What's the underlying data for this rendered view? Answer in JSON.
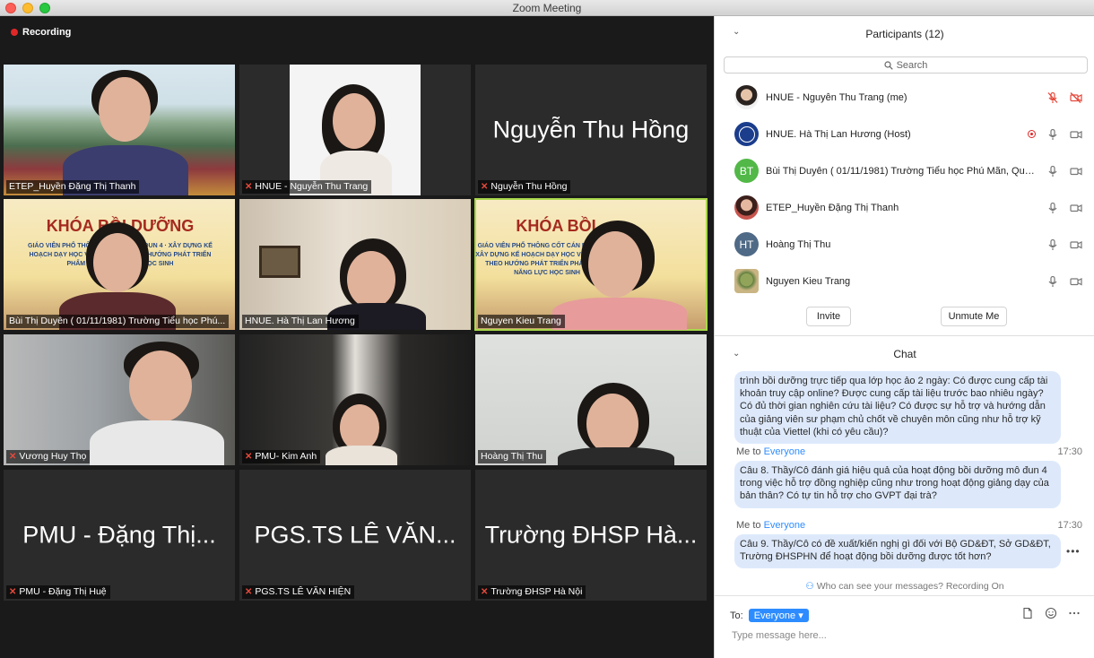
{
  "window": {
    "title": "Zoom Meeting"
  },
  "recording": {
    "label": "Recording"
  },
  "gallery": [
    {
      "name": "ETEP_Huyền Đặng Thị Thanh",
      "muted": false,
      "video": true
    },
    {
      "name": "HNUE - Nguyễn Thu Trang",
      "muted": true,
      "video": true
    },
    {
      "name": "Nguyễn Thu Hồng",
      "muted": true,
      "video": false,
      "big_name": "Nguyễn Thu Hồng"
    },
    {
      "name": "Bùi Thị Duyên ( 01/11/1981) Trường Tiểu học Phú...",
      "muted": false,
      "video": true
    },
    {
      "name": "HNUE. Hà Thị Lan Hương",
      "muted": false,
      "video": true
    },
    {
      "name": "Nguyen Kieu Trang",
      "muted": false,
      "video": true,
      "active": true
    },
    {
      "name": "Vương Huy Thọ",
      "muted": true,
      "video": true
    },
    {
      "name": "PMU- Kim Anh",
      "muted": true,
      "video": true
    },
    {
      "name": "Hoàng Thị Thu",
      "muted": false,
      "video": true
    },
    {
      "name": "PMU - Đặng Thị Huệ",
      "muted": true,
      "video": false,
      "big_name": "PMU - Đặng Thị..."
    },
    {
      "name": "PGS.TS LÊ VĂN HIỆN",
      "muted": true,
      "video": false,
      "big_name": "PGS.TS LÊ VĂN..."
    },
    {
      "name": "Trường ĐHSP Hà Nội",
      "muted": true,
      "video": false,
      "big_name": "Trường ĐHSP Hà..."
    }
  ],
  "banner": {
    "title_left": "KHÓA BỒI DƯỠNG",
    "title_right": "KHÓA BỒI",
    "sub": "GIÁO VIÊN PHỔ THÔNG CỐT CÁN MÔ ĐUN 4 · XÂY DỰNG KẾ HOẠCH DẠY HỌC VÀ GIÁO DỤC THEO HƯỚNG PHÁT TRIỂN PHẨM CHẤT, NĂNG LỰC HỌC SINH"
  },
  "participants_panel": {
    "title": "Participants (12)",
    "search_placeholder": "Search",
    "items": [
      {
        "name": "HNUE - Nguyễn Thu Trang (me)",
        "avatar": "photo",
        "mic": "muted",
        "cam": "off"
      },
      {
        "name": "HNUE. Hà Thị Lan Hương (Host)",
        "avatar": "logo",
        "mic": "on",
        "cam": "on",
        "recording": true
      },
      {
        "name": "Bùi Thị Duyên ( 01/11/1981) Trường Tiểu học Phú Mãn, Quố...",
        "avatar": "initials",
        "initials": "BT",
        "mic": "on",
        "cam": "on"
      },
      {
        "name": "ETEP_Huyền Đặng Thị Thanh",
        "avatar": "photo",
        "mic": "on",
        "cam": "on"
      },
      {
        "name": "Hoàng Thị Thu",
        "avatar": "initials",
        "initials": "HT",
        "mic": "on",
        "cam": "on"
      },
      {
        "name": "Nguyen Kieu Trang",
        "avatar": "photo",
        "mic": "on",
        "cam": "on"
      }
    ],
    "invite_label": "Invite",
    "unmute_label": "Unmute Me"
  },
  "chat": {
    "title": "Chat",
    "messages": [
      {
        "text": "trình bồi dưỡng trực tiếp qua lớp học ảo 2 ngày: Có được cung cấp tài khoản truy cập online? Được cung cấp tài liệu trước bao nhiêu ngày? Có đủ thời gian nghiên cứu tài liệu? Có được sự hỗ trợ và hướng dẫn của giảng viên sư phạm chủ chốt về chuyên môn cũng như hỗ trợ kỹ thuật của Viettel (khi có yêu cầu)?"
      },
      {
        "from": "Me",
        "to_word": "to",
        "to": "Everyone",
        "time": "17:30",
        "text": "Câu 8. Thầy/Cô đánh giá hiệu quả của hoạt động bồi dưỡng mô đun 4 trong việc hỗ trợ đồng nghiệp cũng như trong hoạt động giảng dạy của bản thân? Có tự tin hỗ trợ cho GVPT đại trà?"
      },
      {
        "from": "Me",
        "to_word": "to",
        "to": "Everyone",
        "time": "17:30",
        "text": "Câu 9. Thầy/Cô có đề xuất/kiến nghị gì đối với Bộ GD&ĐT, Sở GD&ĐT, Trường ĐHSPHN để hoạt động bồi dưỡng được tốt hơn?"
      }
    ],
    "visibility_note": "Who can see your messages? Recording On",
    "to_label": "To:",
    "to_value": "Everyone",
    "input_placeholder": "Type message here..."
  },
  "colors": {
    "accent": "#2d8cff",
    "recording": "#e02828",
    "active_speaker": "#a8d84a",
    "bubble": "#dde9fb"
  }
}
